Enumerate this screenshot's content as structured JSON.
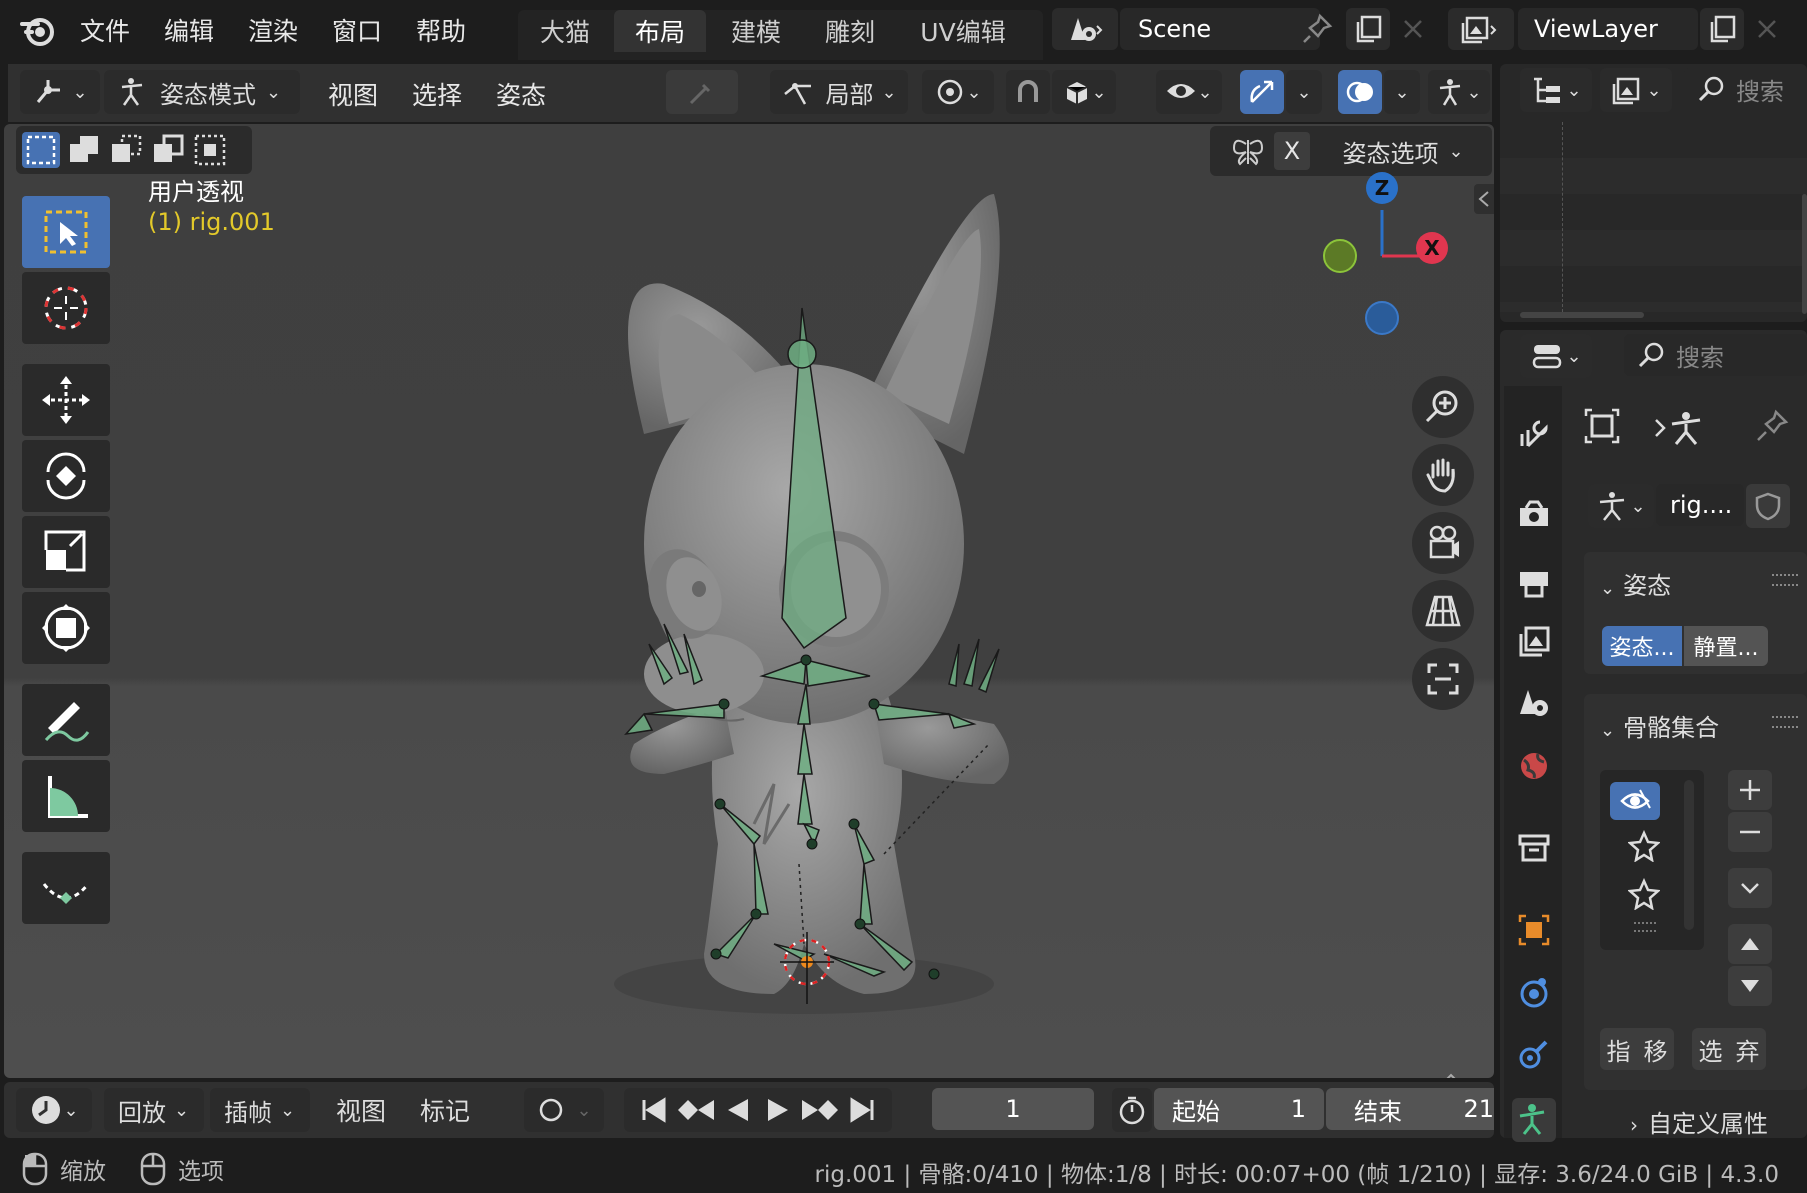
{
  "topbar": {
    "menus": [
      "文件",
      "编辑",
      "渲染",
      "窗口",
      "帮助"
    ],
    "workspaces": [
      "大猫",
      "布局",
      "建模",
      "雕刻",
      "UV编辑"
    ],
    "active_workspace": "布局",
    "scene": "Scene",
    "view_layer": "ViewLayer"
  },
  "viewport_header": {
    "mode": "姿态模式",
    "menus": [
      "视图",
      "选择",
      "姿态"
    ],
    "transform_orientation": "局部",
    "axis_x": "X",
    "pose_options": "姿态选项"
  },
  "viewport": {
    "view_name": "用户透视",
    "object_label": "(1) rig.001",
    "gizmo": {
      "z": "Z",
      "x": "X"
    }
  },
  "outliner": {
    "search_placeholder": "搜索"
  },
  "properties": {
    "search_placeholder": "搜索",
    "object_name": "rig....",
    "pose_panel": {
      "title": "姿态",
      "btn_pose": "姿态...",
      "btn_rest": "静置..."
    },
    "bone_collections": {
      "title": "骨骼集合"
    },
    "buttons": [
      "指",
      "移",
      "选",
      "弃"
    ],
    "custom_props": "自定义属性"
  },
  "timeline": {
    "menus": [
      "回放",
      "插帧",
      "视图",
      "标记"
    ],
    "current_frame": "1",
    "start_label": "起始",
    "start": "1",
    "end_label": "结束",
    "end": "21"
  },
  "statusbar": {
    "zoom": "缩放",
    "options": "选项",
    "info": "rig.001 | 骨骼:0/410 | 物体:1/8 | 时长: 00:07+00 (帧 1/210) | 显存: 3.6/24.0 GiB | 4.3.0"
  },
  "colors": {
    "accent": "#4772b3",
    "bone": "#6fae83",
    "axis_x": "#e0364f",
    "axis_y": "#7ea72b",
    "axis_z": "#2a71c9",
    "label_yellow": "#e3c92a"
  }
}
